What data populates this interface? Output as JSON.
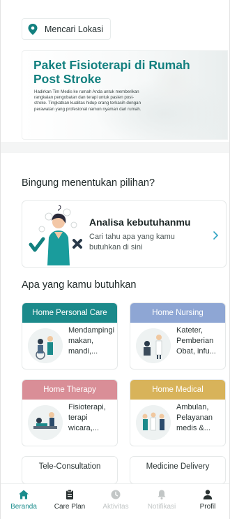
{
  "location": {
    "label": "Mencari Lokasi"
  },
  "banner": {
    "title": "Paket Fisioterapi di Rumah Post Stroke",
    "description": "Hadirkan Tim Medis ke rumah Anda untuk memberikan rangkaian pengobatan dan terapi untuk pasien post-stroke. Tingkatkan kualitas hidup orang terkasih dengan perawatan yang profesional namun nyaman dari rumah."
  },
  "section_help": {
    "title": "Bingung menentukan pilihan?"
  },
  "analysis": {
    "title": "Analisa kebutuhanmu",
    "subtitle": "Cari tahu apa yang kamu butuhkan di sini"
  },
  "section_needs": {
    "title": "Apa yang kamu butuhkan"
  },
  "services": [
    {
      "header": "Home Personal Care",
      "text": "Mendampingi makan, mandi,...",
      "color": "#1c8a8b"
    },
    {
      "header": "Home Nursing",
      "text": "Kateter, Pemberian Obat, infu...",
      "color": "#8ea6d4"
    },
    {
      "header": "Home Therapy",
      "text": "Fisioterapi, terapi wicara,...",
      "color": "#d98e97"
    },
    {
      "header": "Home Medical",
      "text": "Ambulan, Pelayanan medis &...",
      "color": "#d8b35a"
    },
    {
      "header": "Tele-Consultation"
    },
    {
      "header": "Medicine Delivery"
    }
  ],
  "nav": {
    "items": [
      {
        "label": "Beranda",
        "icon": "home-icon",
        "state": "active"
      },
      {
        "label": "Care Plan",
        "icon": "clipboard-icon",
        "state": "normal"
      },
      {
        "label": "Aktivitas",
        "icon": "clock-icon",
        "state": "disabled"
      },
      {
        "label": "Notifikasi",
        "icon": "bell-icon",
        "state": "disabled"
      },
      {
        "label": "Profil",
        "icon": "user-icon",
        "state": "normal"
      }
    ]
  },
  "colors": {
    "brand": "#12807f",
    "accent": "#2fa3c2"
  }
}
